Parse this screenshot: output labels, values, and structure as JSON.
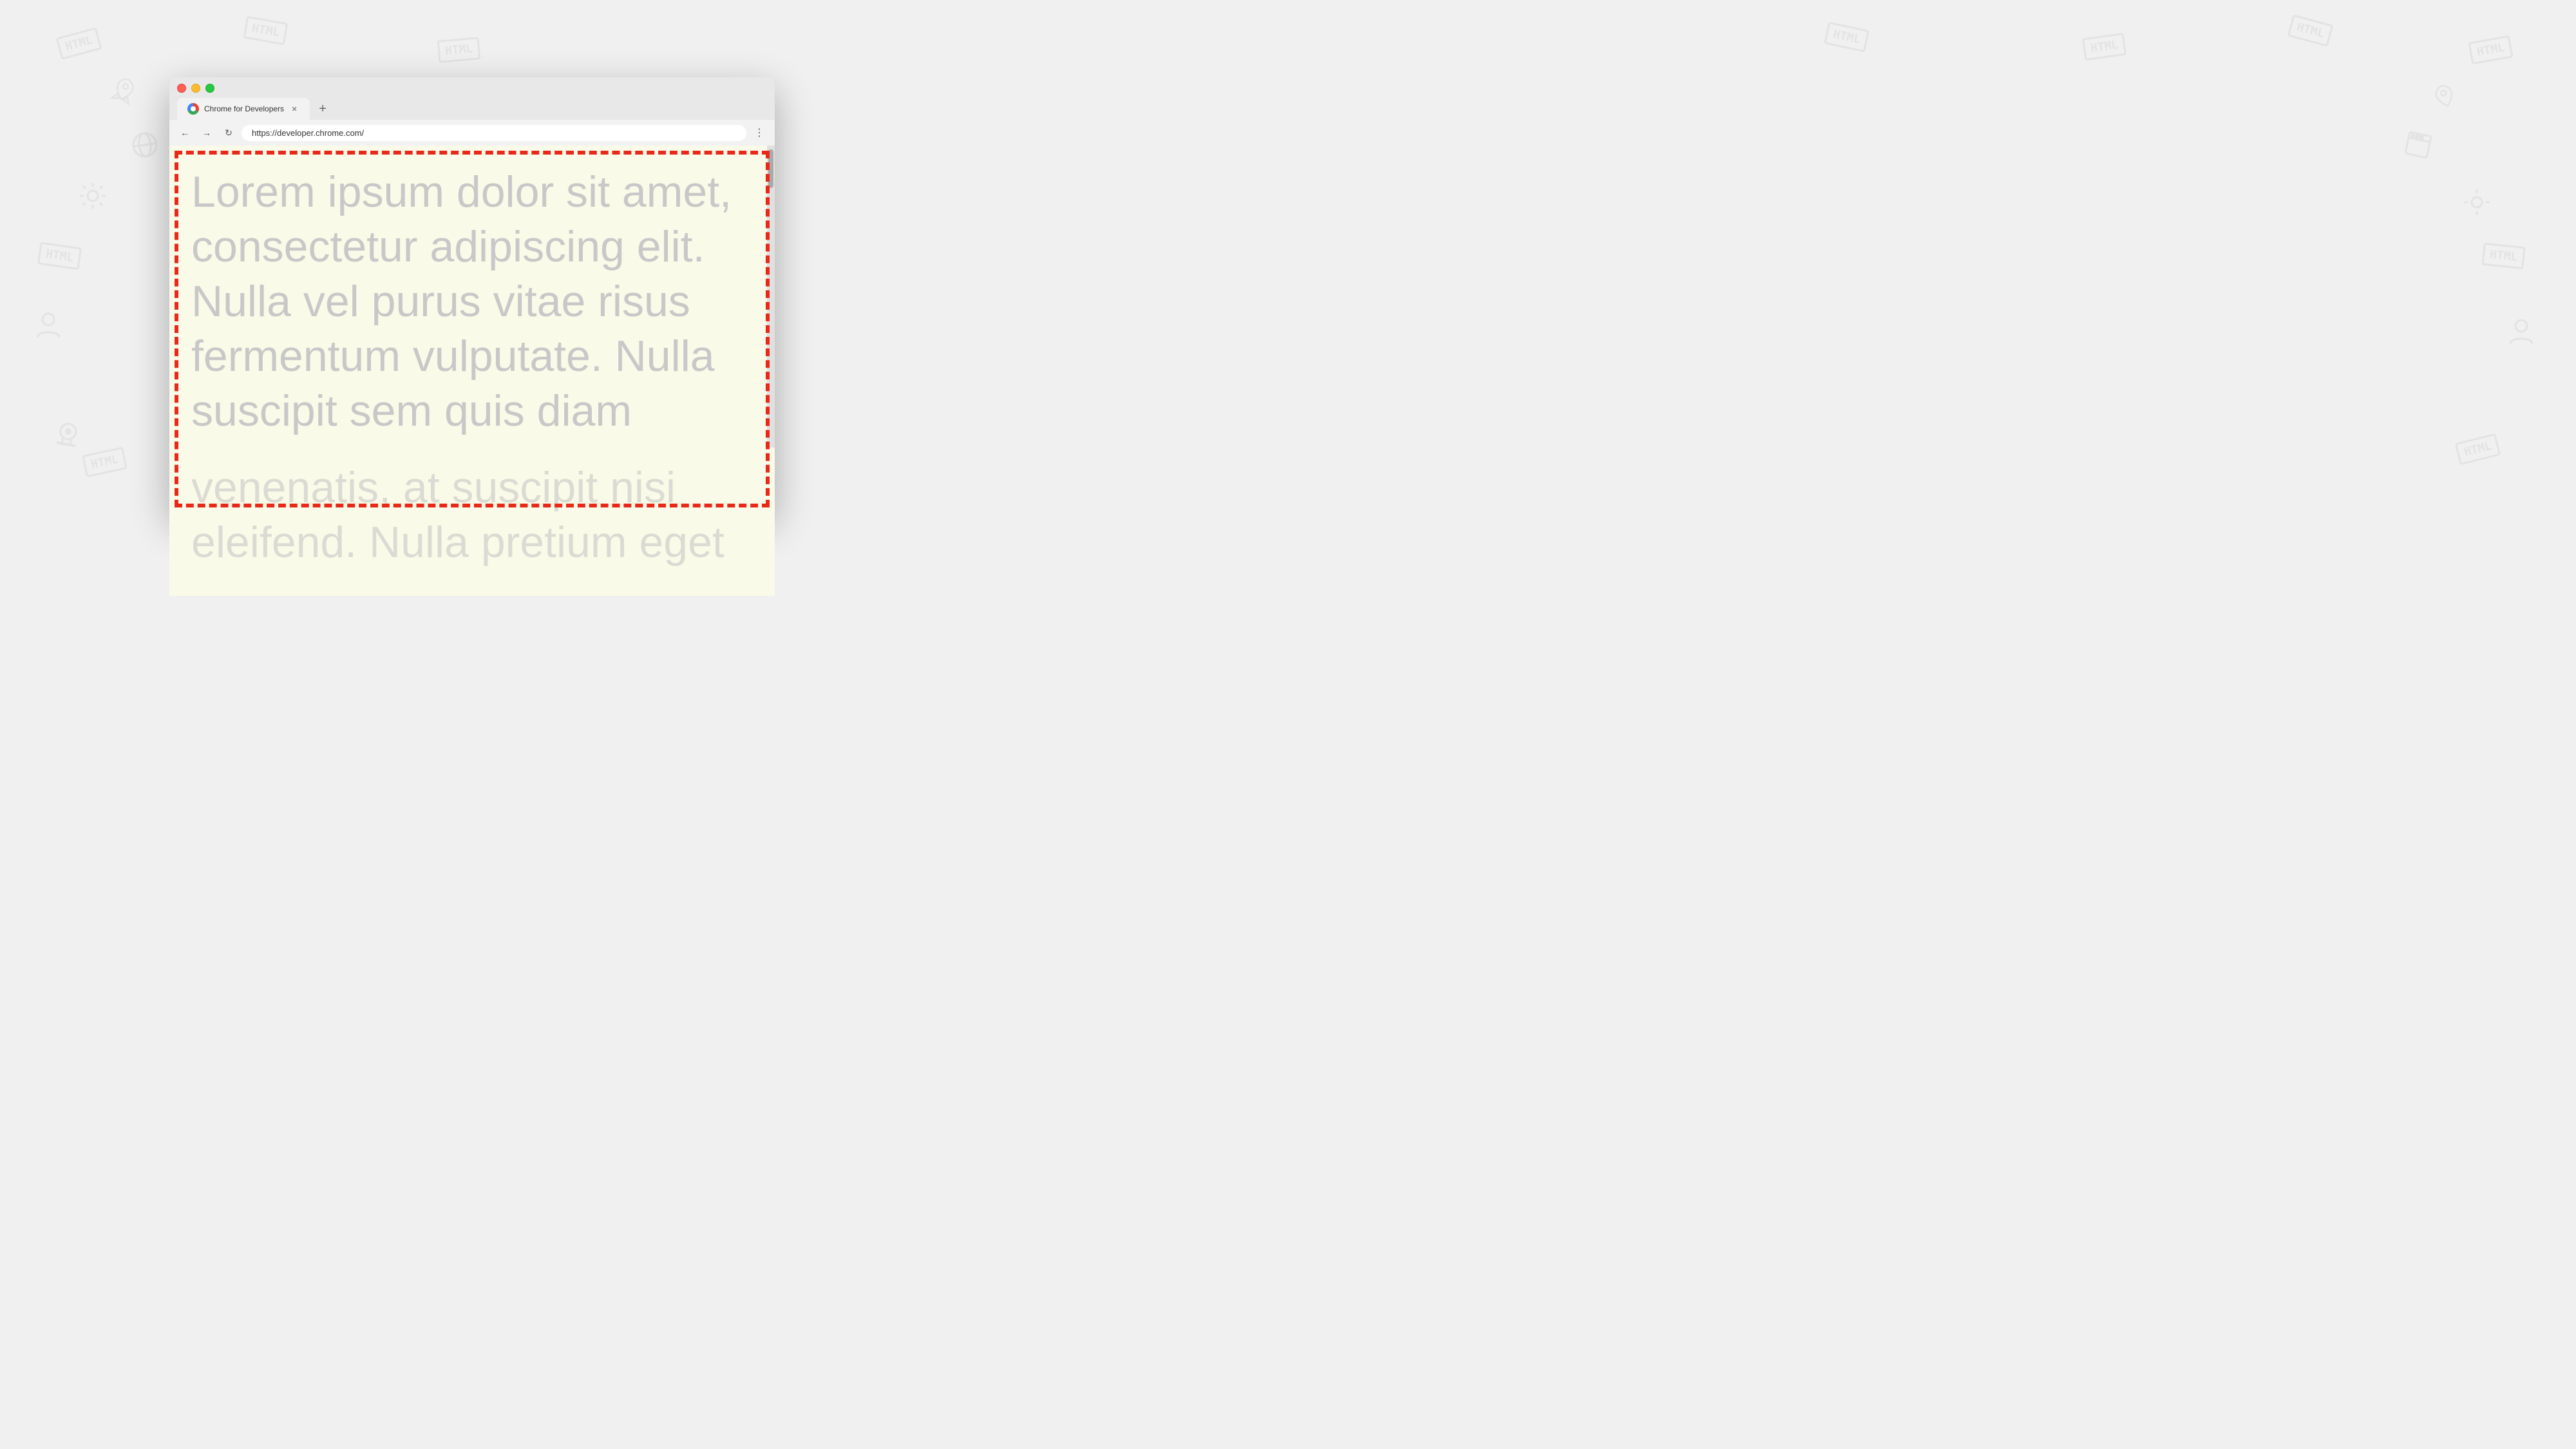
{
  "background": {
    "color": "#f0f0f0"
  },
  "browser": {
    "title": "Chrome for Developers",
    "url": "https://developer.chrome.com/",
    "tab_label": "Chrome for Developers",
    "new_tab_label": "+",
    "nav": {
      "back_label": "←",
      "forward_label": "→",
      "reload_label": "↻",
      "menu_label": "⋮"
    }
  },
  "page": {
    "lorem_line1": "Lorem ipsum dolor sit amet,",
    "lorem_line2": "consectetur adipiscing elit.",
    "lorem_line3": "Nulla vel purus vitae risus",
    "lorem_line4": "fermentum vulputate. Nulla",
    "lorem_line5": "suscipit sem quis diam",
    "lorem_line6": "venenatis, at suscipit nisi",
    "lorem_line7": "eleifend. Nulla pretium eget",
    "background_color": "#fafae8",
    "border_color": "#e8291a",
    "text_color": "#c8c8c8"
  }
}
